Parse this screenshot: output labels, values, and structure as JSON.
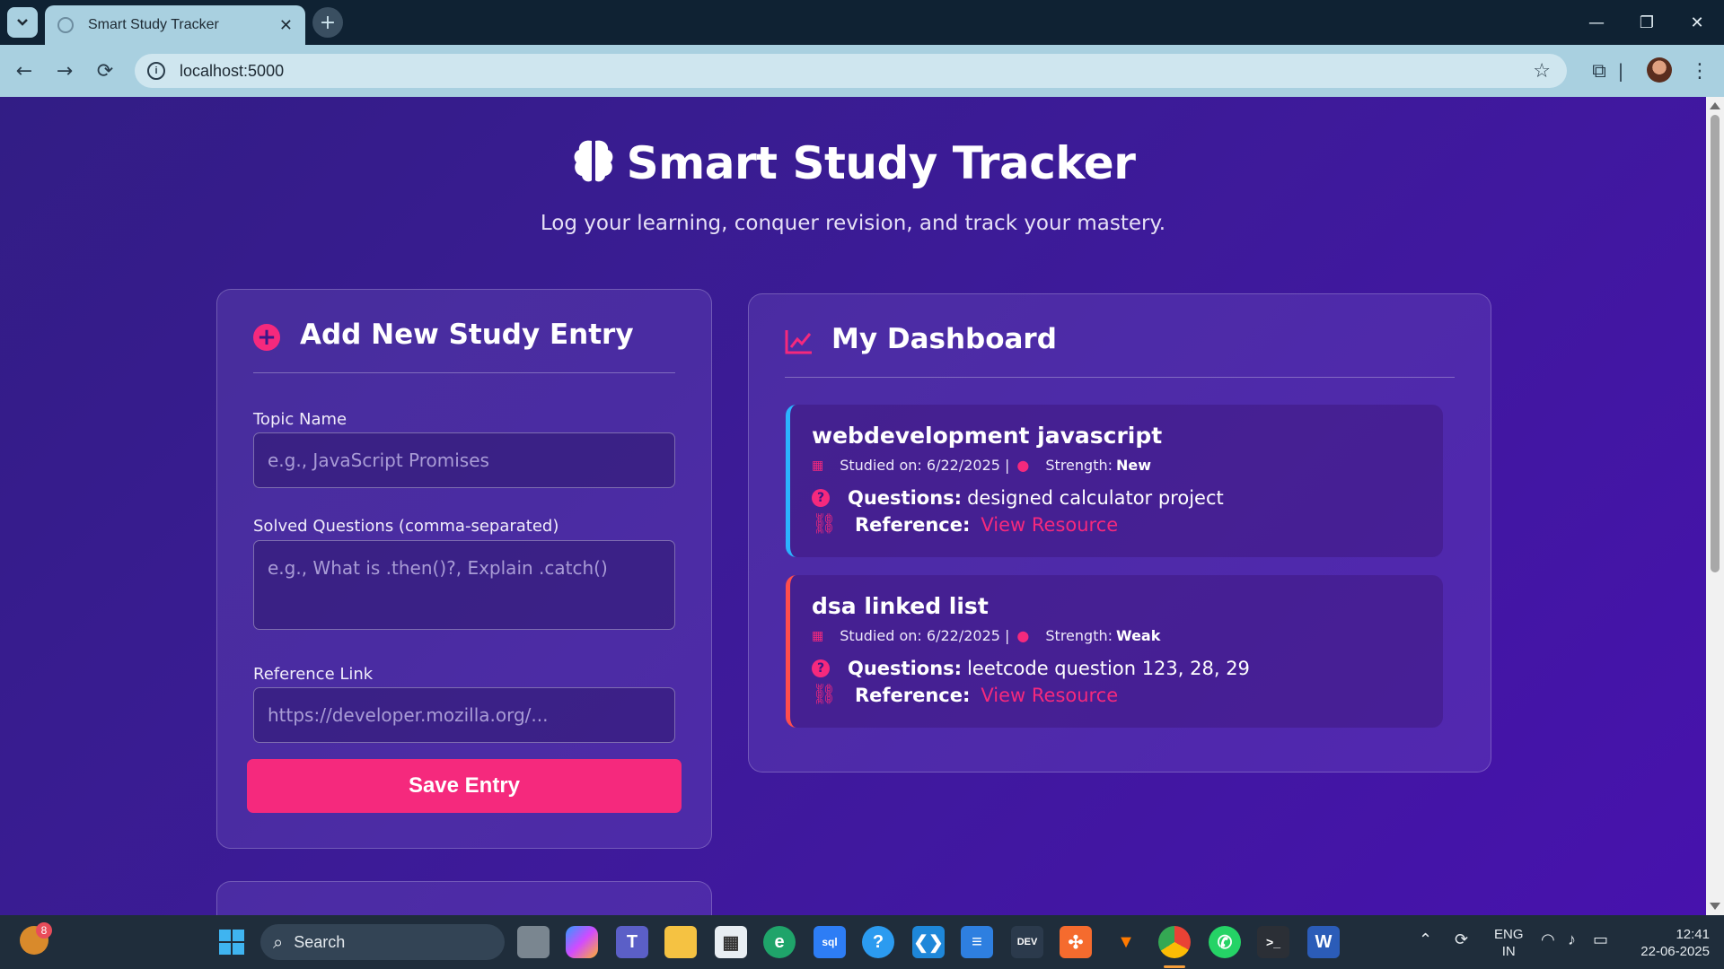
{
  "browser": {
    "tab_title": "Smart Study Tracker",
    "url": "localhost:5000"
  },
  "hero": {
    "title": "Smart Study Tracker",
    "subtitle": "Log your learning, conquer revision, and track your mastery."
  },
  "form": {
    "heading": "Add New Study Entry",
    "topic_label": "Topic Name",
    "topic_placeholder": "e.g., JavaScript Promises",
    "questions_label": "Solved Questions (comma-separated)",
    "questions_placeholder": "e.g., What is .then()?, Explain .catch()",
    "link_label": "Reference Link",
    "link_placeholder": "https://developer.mozilla.org/...",
    "save_label": "Save Entry"
  },
  "dashboard": {
    "heading": "My Dashboard",
    "entries": [
      {
        "topic": "webdevelopment javascript",
        "studied_label": "Studied on: 6/22/2025 |",
        "strength_label": "Strength:",
        "strength": "New",
        "strength_color": "#2bb3ff",
        "questions_label": "Questions:",
        "questions": "designed calculator project",
        "reference_label": "Reference:",
        "reference_link": "View Resource"
      },
      {
        "topic": "dsa linked list",
        "studied_label": "Studied on: 6/22/2025 |",
        "strength_label": "Strength:",
        "strength": "Weak",
        "strength_color": "#ff4d4d",
        "questions_label": "Questions:",
        "questions": "leetcode question 123, 28, 29",
        "reference_label": "Reference:",
        "reference_link": "View Resource"
      }
    ]
  },
  "taskbar": {
    "search_label": "Search",
    "notification_count": "8",
    "lang_primary": "ENG",
    "lang_secondary": "IN",
    "time": "12:41",
    "date": "22-06-2025"
  },
  "colors": {
    "accent": "#f5297d",
    "background_start": "#321d85",
    "background_end": "#4712ad"
  }
}
